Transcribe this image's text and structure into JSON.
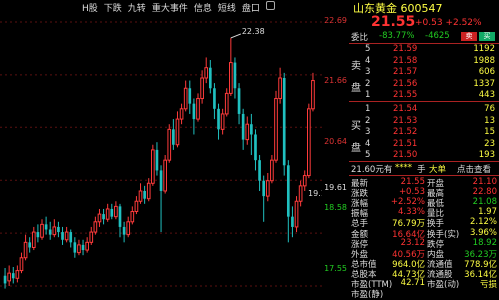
{
  "toolbar": {
    "items": [
      "H股",
      "下跌",
      "九转",
      "重大事件",
      "信息",
      "短线",
      "盘口"
    ]
  },
  "chart": {
    "high_label": "22.38",
    "last_label": "19.1",
    "price_axis": [
      "22.69",
      "21.66",
      "20.64",
      "19.61",
      "18.58",
      "17.55"
    ],
    "candles": [
      [
        17.75,
        17.6,
        17.9,
        17.5
      ],
      [
        17.65,
        17.8,
        17.95,
        17.55
      ],
      [
        17.8,
        17.7,
        17.92,
        17.6
      ],
      [
        17.7,
        17.85,
        17.95,
        17.62
      ],
      [
        17.85,
        18.1,
        18.2,
        17.8
      ],
      [
        18.1,
        18.4,
        18.55,
        18.05
      ],
      [
        18.4,
        18.3,
        18.5,
        18.2
      ],
      [
        18.3,
        18.6,
        18.7,
        18.25
      ],
      [
        18.6,
        18.5,
        18.75,
        18.4
      ],
      [
        18.5,
        18.75,
        18.85,
        18.45
      ],
      [
        18.75,
        18.65,
        18.9,
        18.55
      ],
      [
        18.65,
        18.55,
        18.8,
        18.45
      ],
      [
        18.55,
        18.7,
        18.85,
        18.5
      ],
      [
        18.7,
        18.6,
        18.8,
        18.5
      ],
      [
        18.6,
        18.45,
        18.7,
        18.35
      ],
      [
        18.45,
        18.6,
        18.7,
        18.4
      ],
      [
        18.6,
        18.4,
        18.65,
        18.3
      ],
      [
        18.4,
        18.2,
        18.5,
        18.1
      ],
      [
        18.2,
        18.35,
        18.45,
        18.15
      ],
      [
        18.35,
        18.25,
        18.45,
        18.15
      ],
      [
        18.25,
        18.4,
        18.5,
        18.2
      ],
      [
        18.4,
        18.6,
        18.7,
        18.35
      ],
      [
        18.6,
        18.8,
        18.9,
        18.55
      ],
      [
        18.8,
        18.95,
        19.05,
        18.7
      ],
      [
        18.95,
        18.85,
        19.05,
        18.75
      ],
      [
        18.85,
        19.05,
        19.15,
        18.8
      ],
      [
        19.05,
        18.9,
        19.15,
        18.85
      ],
      [
        18.9,
        19.1,
        19.2,
        18.85
      ],
      [
        19.1,
        18.7,
        19.15,
        18.5
      ],
      [
        18.7,
        18.55,
        18.8,
        18.4
      ],
      [
        18.55,
        18.8,
        18.9,
        18.5
      ],
      [
        18.8,
        19.0,
        19.1,
        18.75
      ],
      [
        19.0,
        19.2,
        19.3,
        18.95
      ],
      [
        19.2,
        19.4,
        19.55,
        19.15
      ],
      [
        19.4,
        19.25,
        19.5,
        19.15
      ],
      [
        19.25,
        19.55,
        19.65,
        19.2
      ],
      [
        19.55,
        20.2,
        20.3,
        19.5
      ],
      [
        20.2,
        19.8,
        20.35,
        19.7
      ],
      [
        19.8,
        19.4,
        19.9,
        18.6
      ],
      [
        19.4,
        20.0,
        20.1,
        19.35
      ],
      [
        20.0,
        20.6,
        20.7,
        19.95
      ],
      [
        20.6,
        20.3,
        20.8,
        20.2
      ],
      [
        20.3,
        20.8,
        20.95,
        20.25
      ],
      [
        20.8,
        21.0,
        21.1,
        20.7
      ],
      [
        21.0,
        21.4,
        21.55,
        20.95
      ],
      [
        21.4,
        21.1,
        21.55,
        20.9
      ],
      [
        21.1,
        20.8,
        21.2,
        20.5
      ],
      [
        20.8,
        21.2,
        21.3,
        20.75
      ],
      [
        21.2,
        21.6,
        21.75,
        21.1
      ],
      [
        21.6,
        21.8,
        22.0,
        21.5
      ],
      [
        21.8,
        21.4,
        21.95,
        21.3
      ],
      [
        21.4,
        21.0,
        21.5,
        20.8
      ],
      [
        21.0,
        20.6,
        21.1,
        20.4
      ],
      [
        20.6,
        20.9,
        21.0,
        20.5
      ],
      [
        20.9,
        21.3,
        21.4,
        20.85
      ],
      [
        21.3,
        21.9,
        22.38,
        21.25
      ],
      [
        21.9,
        21.4,
        22.0,
        21.2
      ],
      [
        21.4,
        20.9,
        21.5,
        20.7
      ],
      [
        20.9,
        20.4,
        21.0,
        20.2
      ],
      [
        20.4,
        20.7,
        20.85,
        20.3
      ],
      [
        20.7,
        20.5,
        20.9,
        20.1
      ],
      [
        20.5,
        20.0,
        20.6,
        19.8
      ],
      [
        20.0,
        19.6,
        20.1,
        19.4
      ],
      [
        19.6,
        19.3,
        19.7,
        18.8
      ],
      [
        19.3,
        19.6,
        19.75,
        19.2
      ],
      [
        19.6,
        20.0,
        20.1,
        19.55
      ],
      [
        20.0,
        21.2,
        21.35,
        19.95
      ],
      [
        21.2,
        21.6,
        21.8,
        21.1
      ],
      [
        21.6,
        19.9,
        21.7,
        19.7
      ],
      [
        19.9,
        18.9,
        20.0,
        18.4
      ],
      [
        18.9,
        18.7,
        19.1,
        18.5
      ],
      [
        18.7,
        19.2,
        19.3,
        18.6
      ],
      [
        19.2,
        19.5,
        19.6,
        19.1
      ],
      [
        19.5,
        19.7,
        19.8,
        19.4
      ],
      [
        19.7,
        21.0,
        21.1,
        19.65
      ],
      [
        21.0,
        21.55,
        21.7,
        20.95
      ]
    ]
  },
  "quote": {
    "title": "山东黄金 600547",
    "price": "21.55",
    "change": "+0.53 +2.52%",
    "wb_label": "委比",
    "wb_value": "-83.77%",
    "wb_diff": "-4625",
    "sell_btn": "卖",
    "buy_btn": "买",
    "sell_side_label": "卖盘",
    "buy_side_label": "买盘",
    "sell_orders": [
      {
        "lvl": "5",
        "price": "21.59",
        "vol": "1192"
      },
      {
        "lvl": "4",
        "price": "21.58",
        "vol": "1988"
      },
      {
        "lvl": "3",
        "price": "21.57",
        "vol": "606"
      },
      {
        "lvl": "2",
        "price": "21.56",
        "vol": "1337"
      },
      {
        "lvl": "1",
        "price": "21.55",
        "vol": "443"
      }
    ],
    "buy_orders": [
      {
        "lvl": "1",
        "price": "21.54",
        "vol": "76"
      },
      {
        "lvl": "2",
        "price": "21.53",
        "vol": "13"
      },
      {
        "lvl": "3",
        "price": "21.52",
        "vol": "15"
      },
      {
        "lvl": "4",
        "price": "21.51",
        "vol": "23"
      },
      {
        "lvl": "5",
        "price": "21.50",
        "vol": "193"
      }
    ],
    "tick_price": "21.60元有",
    "tick_stars": "****",
    "tick_unit": "手",
    "tick_dadan": "大单",
    "tick_click": "点击查看",
    "stats": [
      {
        "l1": "最新",
        "v1": "21.55",
        "l2": "开盘",
        "v2": "21.10"
      },
      {
        "l1": "涨跌",
        "v1": "+0.53",
        "l2": "最高",
        "v2": "22.80"
      },
      {
        "l1": "涨幅",
        "v1": "+2.52%",
        "l2": "最低",
        "v2": "21.08"
      },
      {
        "l1": "振幅",
        "v1": "4.33%",
        "l2": "量比",
        "v2": "1.97"
      },
      {
        "l1": "总手",
        "v1": "76.79万",
        "l2": "换手",
        "v2": "2.12%"
      },
      {
        "l1": "金额",
        "v1": "16.64亿",
        "l2": "换手(实)",
        "v2": "3.96%"
      },
      {
        "l1": "涨停",
        "v1": "23.12",
        "l2": "跌停",
        "v2": "18.92"
      },
      {
        "l1": "外盘",
        "v1": "40.56万",
        "l2": "内盘",
        "v2": "36.23万"
      },
      {
        "l1": "总市值",
        "v1": "964.0亿",
        "l2": "流通值",
        "v2": "778.9亿"
      },
      {
        "l1": "总股本",
        "v1": "44.73亿",
        "l2": "流通股",
        "v2": "36.14亿"
      },
      {
        "l1": "市盈(TTM)",
        "v1": "42.71",
        "l2": "市盈(动)",
        "v2": "亏损"
      },
      {
        "l1": "市盈(静)",
        "v1": "",
        "l2": "",
        "v2": ""
      }
    ]
  }
}
